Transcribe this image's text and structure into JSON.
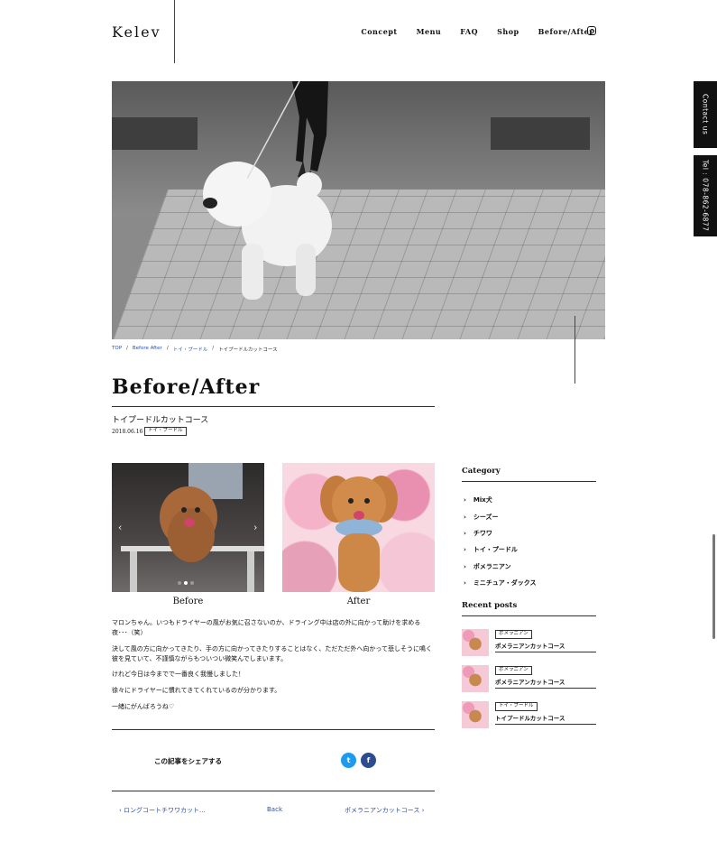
{
  "header": {
    "logo": "Kelev",
    "nav": [
      "Concept",
      "Menu",
      "FAQ",
      "Shop",
      "Before/After"
    ]
  },
  "side_tabs": {
    "contact": "Contact us",
    "tel": "Tel : 078-862-6877"
  },
  "breadcrumb": {
    "home": "TOP",
    "section": "Before After",
    "category": "トイ・プードル",
    "current": "トイプードルカットコース"
  },
  "page": {
    "title": "Before/After",
    "post_title": "トイプードルカットコース",
    "date": "2018.06.16",
    "tag": "トイ・プードル"
  },
  "photos": {
    "before": "Before",
    "after": "After"
  },
  "body": [
    "マロンちゃん。いつもドライヤーの風がお気に召さないのか、ドライング中は店の外に向かって助けを求める夜･･･（笑）",
    "決して風の方に向かってきたり、手の方に向かってきたりすることはなく、ただただ外へ向かって悲しそうに鳴く彼を見ていて、不謹慎ながらもついつい微笑んでしまいます。",
    "けれど今日は今までで一番良く我慢しました！",
    "徐々にドライヤーに慣れてきてくれているのが分かります。",
    "一緒にがんばろうね♡"
  ],
  "share": {
    "label": "この記事をシェアする",
    "twitter": "t",
    "facebook": "f"
  },
  "pager": {
    "prev": "ロングコートチワワカット...",
    "back": "Back",
    "next": "ポメラニアンカットコース"
  },
  "sidebar": {
    "category_heading": "Category",
    "categories": [
      "Mix犬",
      "シーズー",
      "チワワ",
      "トイ・プードル",
      "ポメラニアン",
      "ミニチュア・ダックス"
    ],
    "recent_heading": "Recent posts",
    "recent": [
      {
        "tag": "ポメラニアン",
        "title": "ポメラニアンカットコース"
      },
      {
        "tag": "ポメラニアン",
        "title": "ポメラニアンカットコース"
      },
      {
        "tag": "トイ・プードル",
        "title": "トイプードルカットコース"
      }
    ]
  },
  "colors": {
    "link": "#2a4fb0",
    "twitter": "#1d9bf0",
    "facebook": "#2d4c8f"
  }
}
